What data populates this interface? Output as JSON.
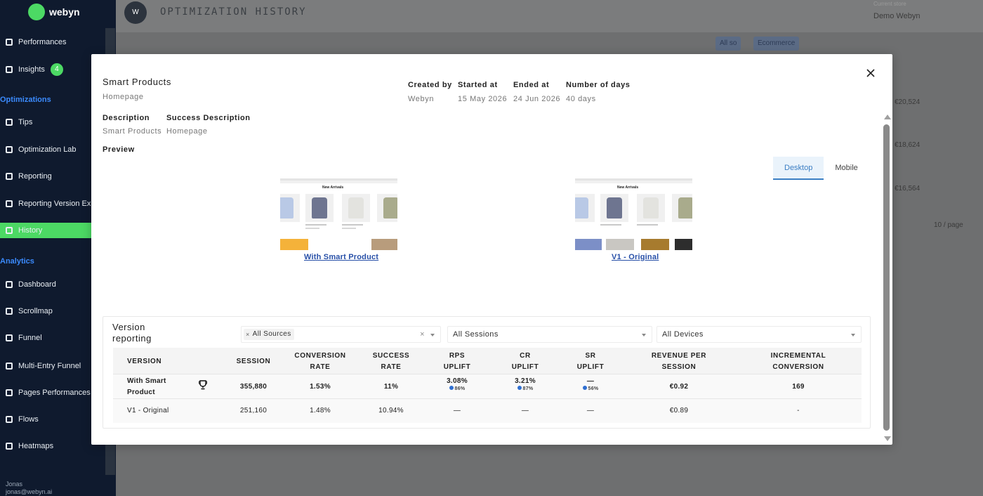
{
  "app": {
    "logo_text": "webyn",
    "page_heading": "OPTIMIZATION HISTORY",
    "avatar": "W",
    "store_label": "Current store",
    "store_value": "Demo Webyn",
    "sidebar": {
      "items": [
        {
          "label": "Performances"
        },
        {
          "label": "Insights",
          "badge": "4"
        },
        {
          "label": "Tips"
        },
        {
          "label": "Optimization Lab"
        },
        {
          "label": "Reporting"
        },
        {
          "label": "Reporting Version Ex"
        },
        {
          "label": "History"
        },
        {
          "label": "Dashboard"
        },
        {
          "label": "Scrollmap"
        },
        {
          "label": "Funnel"
        },
        {
          "label": "Multi-Entry Funnel"
        },
        {
          "label": "Pages Performances"
        },
        {
          "label": "Flows"
        },
        {
          "label": "Heatmaps"
        }
      ],
      "sections": [
        "Optimizations",
        "Analytics"
      ],
      "footer_name": "Jonas",
      "footer_email": "jonas@webyn.ai"
    },
    "background": {
      "chip_a": "All so",
      "chip_b": "Ecommerce",
      "row_values": [
        "€20,524",
        "€18,624",
        "€16,564"
      ],
      "pager": "10 / page"
    }
  },
  "modal": {
    "title": "Smart Products",
    "subtitle": "Homepage",
    "meta": {
      "created_by_label": "Created by",
      "created_by_value": "Webyn",
      "started_at_label": "Started at",
      "started_at_value": "15 May 2026",
      "ended_at_label": "Ended at",
      "ended_at_value": "24 Jun 2026",
      "days_label": "Number of days",
      "days_value": "40 days"
    },
    "description_label": "Description",
    "description_value": "Smart Products",
    "success_description_label": "Success Description",
    "success_description_value": "Homepage",
    "preview_label": "Preview",
    "device_tabs": [
      {
        "label": "Desktop",
        "active": true
      },
      {
        "label": "Mobile",
        "active": false
      }
    ],
    "previews": [
      {
        "link": "With Smart Product",
        "heading": "New Arrivals"
      },
      {
        "link": "V1 - Original",
        "heading": "New Arrivals"
      }
    ],
    "report": {
      "title": "Version reporting",
      "filter_source_tag": "All Sources",
      "filter_sessions": "All Sessions",
      "filter_devices": "All Devices",
      "headers": {
        "version": "VERSION",
        "session": "SESSION",
        "conversion_rate": [
          "CONVERSION",
          "RATE"
        ],
        "success_rate": [
          "SUCCESS",
          "RATE"
        ],
        "rps_uplift": [
          "RPS",
          "UPLIFT"
        ],
        "cr_uplift": [
          "CR",
          "UPLIFT"
        ],
        "sr_uplift": [
          "SR",
          "UPLIFT"
        ],
        "revenue_per_session": [
          "REVENUE PER",
          "SESSION"
        ],
        "incremental_conversion": [
          "INCREMENTAL",
          "CONVERSION"
        ]
      },
      "rows": [
        {
          "version": [
            "With Smart",
            "Product"
          ],
          "winner": true,
          "session": "355,880",
          "conversion_rate": "1.53%",
          "success_rate": "11%",
          "rps_uplift": "3.08%",
          "rps_conf": "86%",
          "cr_uplift": "3.21%",
          "cr_conf": "87%",
          "sr_uplift": "—",
          "sr_conf": "56%",
          "revenue_per_session": "€0.92",
          "incremental_conversion": "169"
        },
        {
          "version": [
            "V1 - Original",
            ""
          ],
          "winner": false,
          "session": "251,160",
          "conversion_rate": "1.48%",
          "success_rate": "10.94%",
          "rps_uplift": "—",
          "cr_uplift": "—",
          "sr_uplift": "—",
          "revenue_per_session": "€0.89",
          "incremental_conversion": "-"
        }
      ]
    }
  },
  "colors": {
    "accent_green": "#4cd964",
    "link_blue": "#2850a8",
    "tab_active": "#3c7fc4",
    "sidebar_bg": "#0f1a2e"
  }
}
